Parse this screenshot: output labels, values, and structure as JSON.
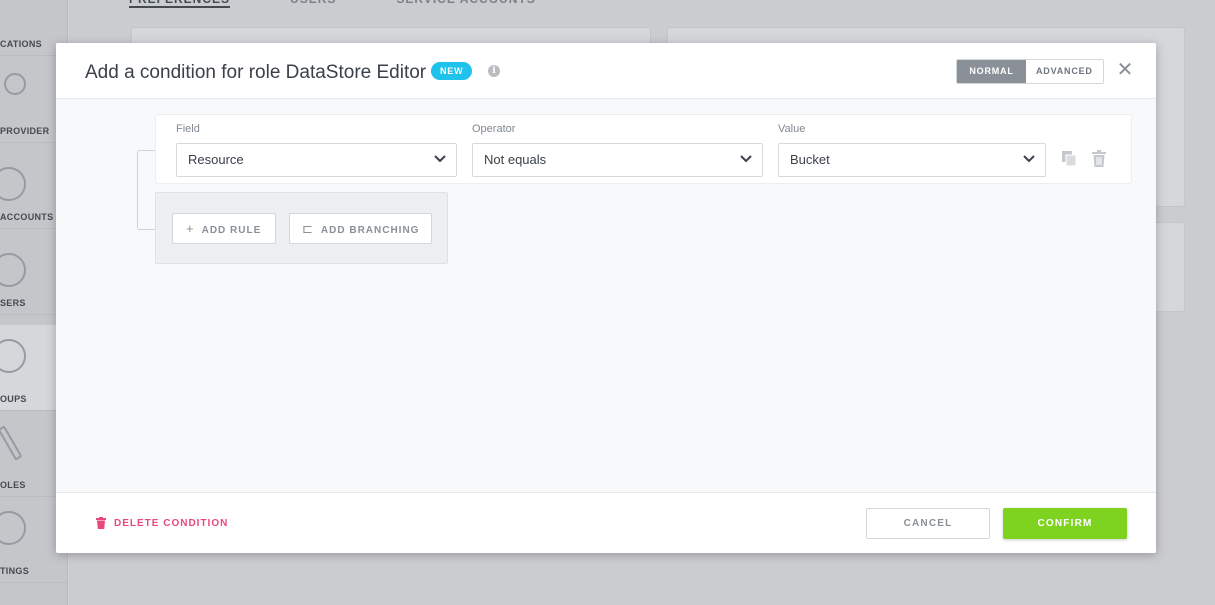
{
  "background": {
    "sidebar": {
      "items": [
        {
          "label": "CATIONS"
        },
        {
          "label": "PROVIDER"
        },
        {
          "label": "ACCOUNTS"
        },
        {
          "label": "SERS"
        },
        {
          "label": "OUPS"
        },
        {
          "label": "OLES"
        },
        {
          "label": "TINGS"
        }
      ],
      "active_index": 4
    },
    "tabs": [
      {
        "label": "PREFERENCES"
      },
      {
        "label": "USERS"
      },
      {
        "label": "SERVICE ACCOUNTS"
      }
    ]
  },
  "modal": {
    "title": "Add a condition for role DataStore Editor",
    "badge": "NEW",
    "info_glyph": "i",
    "mode": {
      "normal_label": "NORMAL",
      "advanced_label": "ADVANCED",
      "selected": "NORMAL"
    },
    "close_glyph": "✕",
    "rule": {
      "field_label": "Field",
      "field_value": "Resource",
      "operator_label": "Operator",
      "operator_value": "Not equals",
      "value_label": "Value",
      "value_value": "Bucket"
    },
    "actions": {
      "add_rule_glyph": "+",
      "add_rule": "ADD RULE",
      "add_branching_glyph": "⊏",
      "add_branching": "ADD BRANCHING"
    },
    "footer": {
      "delete": "DELETE CONDITION",
      "cancel": "CANCEL",
      "confirm": "CONFIRM"
    }
  },
  "colors": {
    "accent_blue": "#1ec2ea",
    "confirm_green": "#7ed321",
    "delete_pink": "#e8497a"
  }
}
